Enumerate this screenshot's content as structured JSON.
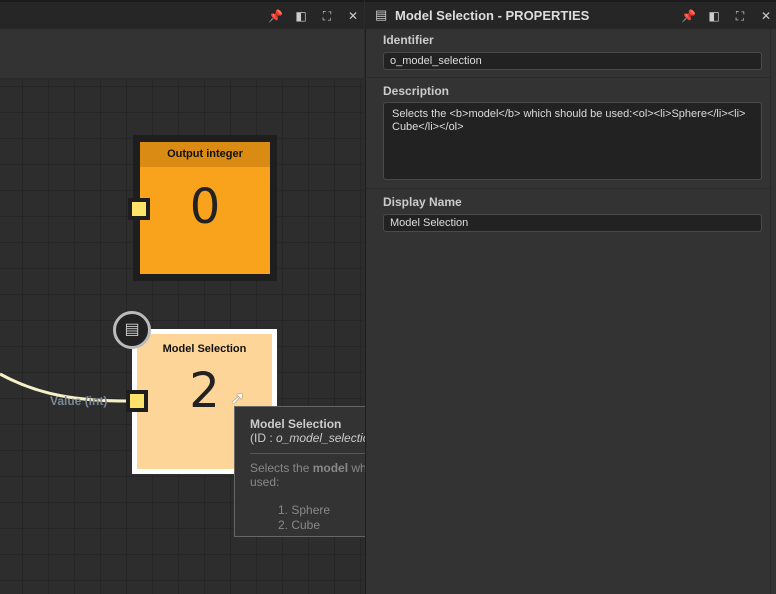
{
  "left_panel": {
    "toolbar_icons": [
      "pin-icon",
      "dock-icon",
      "maximize-icon",
      "close-icon"
    ]
  },
  "graph": {
    "output_node": {
      "title": "Output integer",
      "value": "0"
    },
    "model_node": {
      "title": "Model Selection",
      "value": "2",
      "port_label": "Value (int)"
    },
    "tooltip": {
      "title": "Model Selection",
      "id_prefix": "(ID : ",
      "id": "o_model_selection",
      "id_suffix": ")",
      "desc_pre": "Selects the ",
      "desc_bold": "model",
      "desc_post": " which should be used:",
      "items": [
        "1. Sphere",
        "2. Cube"
      ]
    }
  },
  "properties": {
    "title": "Model Selection - PROPERTIES",
    "identifier_label": "Identifier",
    "identifier_value": "o_model_selection",
    "description_label": "Description",
    "description_value": "Selects the <b>model</b> which should be used:<ol><li>Sphere</li><li>Cube</li></ol>",
    "display_name_label": "Display Name",
    "display_name_value": "Model Selection"
  },
  "colors": {
    "output_header": "#d98b13",
    "output_body": "#f9a21b",
    "model_body": "#fdd599",
    "port": "#fce36a",
    "wire": "#f5f0c8"
  }
}
